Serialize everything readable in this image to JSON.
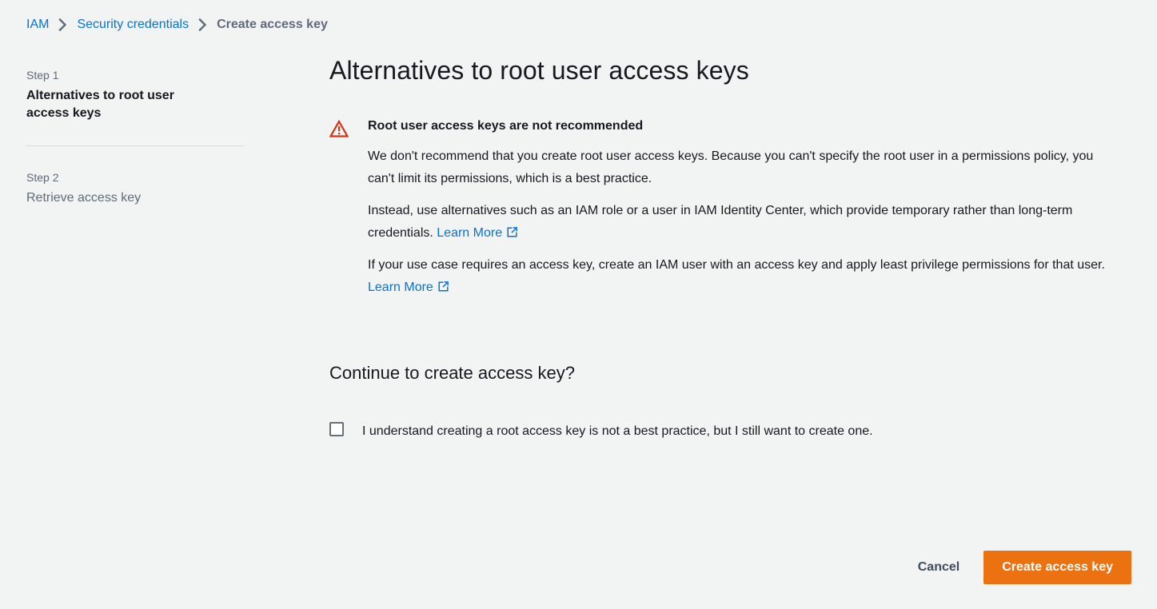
{
  "breadcrumb": {
    "items": [
      {
        "label": "IAM",
        "current": false
      },
      {
        "label": "Security credentials",
        "current": false
      },
      {
        "label": "Create access key",
        "current": true
      }
    ],
    "separator_icon": "chevron-right-icon"
  },
  "steps": [
    {
      "step_label": "Step 1",
      "title": "Alternatives to root user access keys",
      "active": true
    },
    {
      "step_label": "Step 2",
      "title": "Retrieve access key",
      "active": false
    }
  ],
  "main": {
    "title": "Alternatives to root user access keys",
    "alert": {
      "icon": "warning-triangle-icon",
      "icon_color": "#d13212",
      "heading": "Root user access keys are not recommended",
      "paragraph_1": "We don't recommend that you create root user access keys. Because you can't specify the root user in a permissions policy, you can't limit its permissions, which is a best practice.",
      "paragraph_2_text": "Instead, use alternatives such as an IAM role or a user in IAM Identity Center, which provide temporary rather than long-term credentials.",
      "paragraph_2_link": "Learn More",
      "paragraph_3_text": "If your use case requires an access key, create an IAM user with an access key and apply least privilege permissions for that user.",
      "paragraph_3_link": "Learn More",
      "link_icon": "external-link-icon"
    },
    "continue_section": {
      "title": "Continue to create access key?",
      "checkbox_label": "I understand creating a root access key is not a best practice, but I still want to create one.",
      "checkbox_checked": false
    }
  },
  "footer": {
    "cancel_label": "Cancel",
    "primary_label": "Create access key"
  },
  "colors": {
    "page_background": "#f2f3f3",
    "link_blue": "#0972d3",
    "accent_orange": "#ec7211",
    "warning_red": "#d13212",
    "text_dark": "#16191f",
    "text_muted": "#5f6b7a",
    "divider": "#d5dbdb"
  }
}
